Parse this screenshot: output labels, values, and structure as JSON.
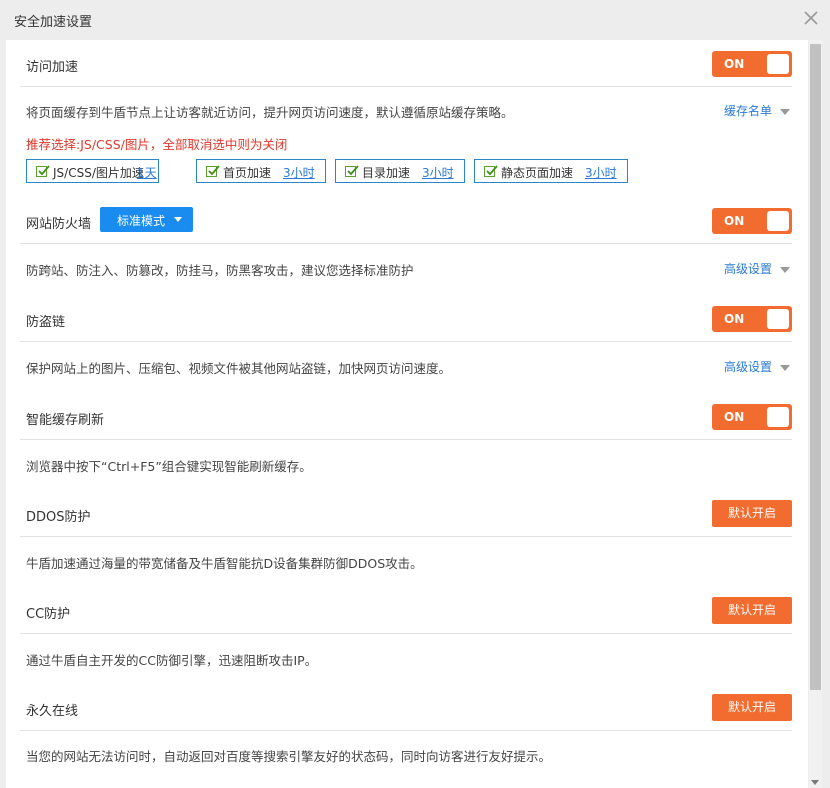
{
  "window": {
    "title": "安全加速设置"
  },
  "sections": {
    "access_accel": {
      "name": "访问加速",
      "toggle": "ON",
      "desc": "将页面缓存到牛盾节点上让访客就近访问，提升网页访问速度，默认遵循原站缓存策略。",
      "link": "缓存名单",
      "recommend": "推荐选择:JS/CSS/图片，全部取消选中则为关闭",
      "options": [
        {
          "label": "JS/CSS/图片加速",
          "duration": "1天",
          "checked": true
        },
        {
          "label": "首页加速",
          "duration": "3小时",
          "checked": true
        },
        {
          "label": "目录加速",
          "duration": "3小时",
          "checked": true
        },
        {
          "label": "静态页面加速",
          "duration": "3小时",
          "checked": true
        }
      ]
    },
    "firewall": {
      "name": "网站防火墙",
      "mode": "标准模式",
      "toggle": "ON",
      "desc": "防跨站、防注入、防篡改，防挂马，防黑客攻击，建议您选择标准防护",
      "link": "高级设置"
    },
    "hotlink": {
      "name": "防盗链",
      "toggle": "ON",
      "desc": "保护网站上的图片、压缩包、视频文件被其他网站盗链，加快网页访问速度。",
      "link": "高级设置"
    },
    "smart_cache": {
      "name": "智能缓存刷新",
      "toggle": "ON",
      "desc": "浏览器中按下“Ctrl+F5”组合键实现智能刷新缓存。"
    },
    "ddos": {
      "name": "DDOS防护",
      "button": "默认开启",
      "desc": "牛盾加速通过海量的带宽储备及牛盾智能抗D设备集群防御DDOS攻击。"
    },
    "cc": {
      "name": "CC防护",
      "button": "默认开启",
      "desc": "通过牛盾自主开发的CC防御引擎，迅速阻断攻击IP。"
    },
    "always_online": {
      "name": "永久在线",
      "button": "默认开启",
      "desc": "当您的网站无法访问时，自动返回对百度等搜索引擎友好的状态码，同时向访客进行友好提示。"
    }
  },
  "colors": {
    "accent": "#f26b2f",
    "link": "#2a7ad8",
    "mode_button": "#1a8cf0",
    "recommend": "#e0382b"
  },
  "icons": {
    "close": "close-icon",
    "check": "check-icon",
    "dropdown": "chevron-down-icon"
  }
}
